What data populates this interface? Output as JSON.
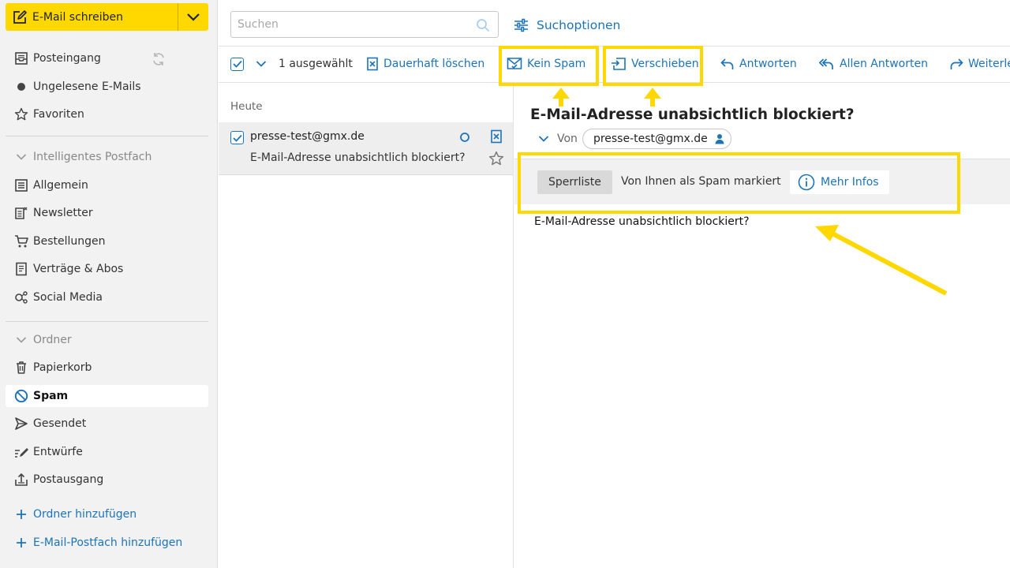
{
  "compose": {
    "label": "E-Mail schreiben"
  },
  "sidebar": {
    "items": [
      {
        "label": "Posteingang"
      },
      {
        "label": "Ungelesene E-Mails"
      },
      {
        "label": "Favoriten"
      }
    ],
    "smart_section": {
      "label": "Intelligentes Postfach"
    },
    "smart_items": [
      {
        "label": "Allgemein"
      },
      {
        "label": "Newsletter"
      },
      {
        "label": "Bestellungen"
      },
      {
        "label": "Verträge & Abos"
      },
      {
        "label": "Social Media"
      }
    ],
    "folder_section": {
      "label": "Ordner"
    },
    "folders": [
      {
        "label": "Papierkorb"
      },
      {
        "label": "Spam"
      },
      {
        "label": "Gesendet"
      },
      {
        "label": "Entwürfe"
      },
      {
        "label": "Postausgang"
      }
    ],
    "add_folder": "Ordner hinzufügen",
    "add_mailbox": "E-Mail-Postfach hinzufügen"
  },
  "search": {
    "placeholder": "Suchen",
    "options_label": "Suchoptionen"
  },
  "toolbar": {
    "selected_count": "1 ausgewählt",
    "delete_label": "Dauerhaft löschen",
    "not_spam_label": "Kein Spam",
    "move_label": "Verschieben",
    "reply_label": "Antworten",
    "reply_all_label": "Allen Antworten",
    "forward_label": "Weiterleiten"
  },
  "list": {
    "group_heading": "Heute",
    "messages": [
      {
        "from": "presse-test@gmx.de",
        "subject": "E-Mail-Adresse unabsichtlich blockiert?"
      }
    ]
  },
  "reader": {
    "subject": "E-Mail-Adresse unabsichtlich blockiert?",
    "from_label": "Von",
    "from_address": "presse-test@gmx.de",
    "blocklist_button": "Sperrliste",
    "spam_notice": "Von Ihnen als Spam markiert",
    "more_info": "Mehr Infos",
    "body_text": "E-Mail-Adresse unabsichtlich blockiert?"
  },
  "colors": {
    "accent_yellow": "#ffd800",
    "link_blue": "#1d73b8",
    "sidebar_bg": "#f2f2f2"
  }
}
